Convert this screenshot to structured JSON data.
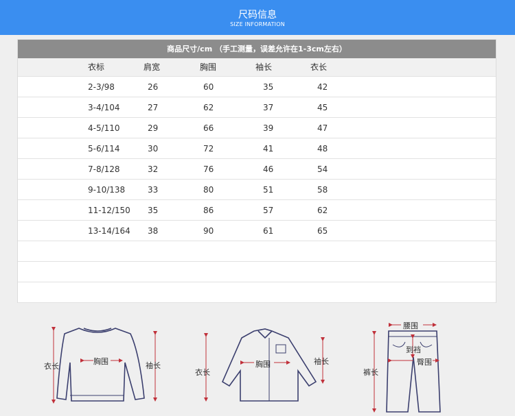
{
  "header": {
    "title": "尺码信息",
    "subtitle": "SIZE INFORMATION"
  },
  "table": {
    "caption": "商品尺寸/cm （手工测量，误差允许在1-3cm左右）",
    "columns": [
      "衣标",
      "肩宽",
      "胸围",
      "袖长",
      "衣长"
    ],
    "rows": [
      [
        "2-3/98",
        "26",
        "60",
        "35",
        "42"
      ],
      [
        "3-4/104",
        "27",
        "62",
        "37",
        "45"
      ],
      [
        "4-5/110",
        "29",
        "66",
        "39",
        "47"
      ],
      [
        "5-6/114",
        "30",
        "72",
        "41",
        "48"
      ],
      [
        "7-8/128",
        "32",
        "76",
        "46",
        "54"
      ],
      [
        "9-10/138",
        "33",
        "80",
        "51",
        "58"
      ],
      [
        "11-12/150",
        "35",
        "86",
        "57",
        "62"
      ],
      [
        "13-14/164",
        "38",
        "90",
        "61",
        "65"
      ]
    ]
  },
  "diagrams": {
    "sweater": {
      "length": "衣长",
      "chest": "胸围",
      "sleeve": "袖长"
    },
    "shirt": {
      "length": "衣长",
      "chest": "胸围",
      "sleeve": "袖长"
    },
    "pants": {
      "waist": "腰围",
      "pants_length": "裤长",
      "crotch": "到裆",
      "hip": "臀围"
    },
    "colors": {
      "garment": "#3b3f6e",
      "arrow": "#c0303a"
    }
  }
}
